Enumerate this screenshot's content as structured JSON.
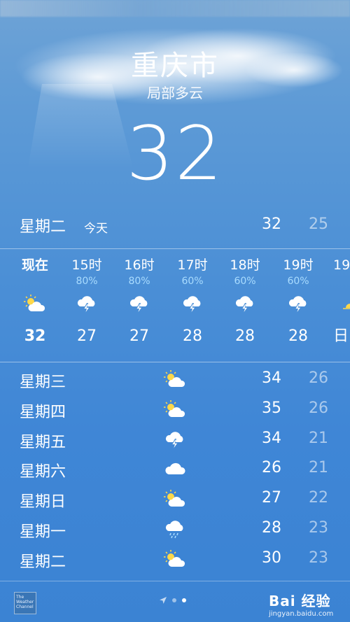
{
  "header": {
    "city": "重庆市",
    "condition": "局部多云",
    "temperature": "32"
  },
  "today": {
    "day": "星期二",
    "tag": "今天",
    "high": "32",
    "low": "25"
  },
  "hourly": [
    {
      "time": "现在",
      "precip": "",
      "icon": "sun-cloud-icon",
      "temp": "32"
    },
    {
      "time": "15时",
      "precip": "80%",
      "icon": "thunderstorm-icon",
      "temp": "27"
    },
    {
      "time": "16时",
      "precip": "80%",
      "icon": "thunderstorm-icon",
      "temp": "27"
    },
    {
      "time": "17时",
      "precip": "60%",
      "icon": "thunderstorm-icon",
      "temp": "28"
    },
    {
      "time": "18时",
      "precip": "60%",
      "icon": "thunderstorm-icon",
      "temp": "28"
    },
    {
      "time": "19时",
      "precip": "60%",
      "icon": "thunderstorm-icon",
      "temp": "28"
    },
    {
      "time": "19",
      "precip": "",
      "icon": "sunset-icon",
      "temp": "日"
    }
  ],
  "daily": [
    {
      "day": "星期三",
      "icon": "sun-cloud-icon",
      "high": "34",
      "low": "26"
    },
    {
      "day": "星期四",
      "icon": "sun-cloud-icon",
      "high": "35",
      "low": "26"
    },
    {
      "day": "星期五",
      "icon": "thunderstorm-icon",
      "high": "34",
      "low": "21"
    },
    {
      "day": "星期六",
      "icon": "cloud-icon",
      "high": "26",
      "low": "21"
    },
    {
      "day": "星期日",
      "icon": "sun-cloud-icon",
      "high": "27",
      "low": "22"
    },
    {
      "day": "星期一",
      "icon": "rain-icon",
      "high": "28",
      "low": "23"
    },
    {
      "day": "星期二",
      "icon": "sun-cloud-icon",
      "high": "30",
      "low": "23"
    }
  ],
  "footer": {
    "logo_lines": [
      "The",
      "Weather",
      "Channel"
    ],
    "watermark_brand": "Bai 经验",
    "watermark_url": "jingyan.baidu.com"
  }
}
